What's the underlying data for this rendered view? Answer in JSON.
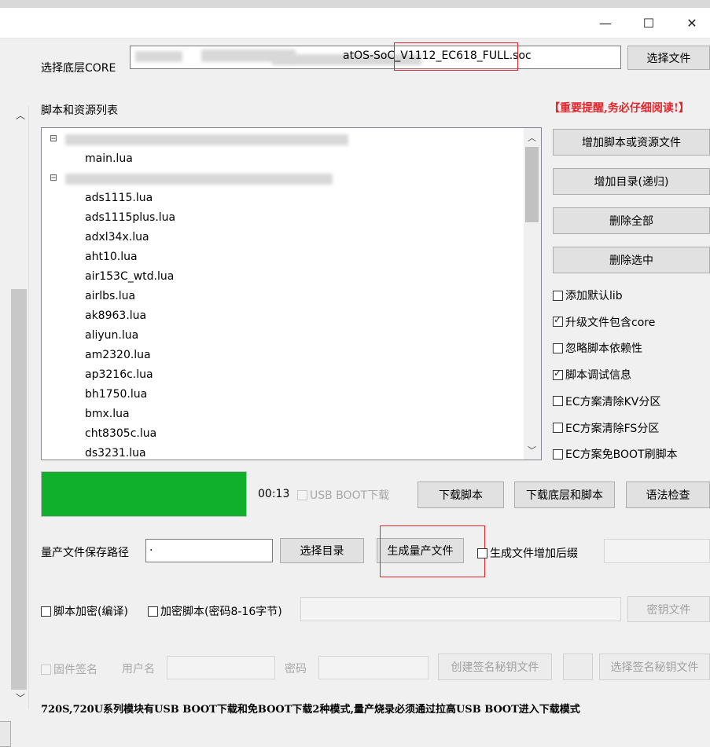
{
  "window": {
    "minimize": "—",
    "maximize": "☐",
    "close": "✕"
  },
  "core": {
    "label": "选择底层CORE",
    "path_value": "atOS-SoC_V1112_EC618_FULL.soc",
    "select_button": "选择文件"
  },
  "scripts": {
    "label": "脚本和资源列表",
    "warning": "【重要提醒,务必仔细阅读!】",
    "tree": [
      {
        "text": "⊟",
        "kind": "expander"
      },
      {
        "text": "main.lua",
        "kind": "file"
      },
      {
        "text": "⊟",
        "kind": "expander"
      },
      {
        "text": "ads1115.lua",
        "kind": "file"
      },
      {
        "text": "ads1115plus.lua",
        "kind": "file"
      },
      {
        "text": "adxl34x.lua",
        "kind": "file"
      },
      {
        "text": "aht10.lua",
        "kind": "file"
      },
      {
        "text": "air153C_wtd.lua",
        "kind": "file"
      },
      {
        "text": "airlbs.lua",
        "kind": "file"
      },
      {
        "text": "ak8963.lua",
        "kind": "file"
      },
      {
        "text": "aliyun.lua",
        "kind": "file"
      },
      {
        "text": "am2320.lua",
        "kind": "file"
      },
      {
        "text": "ap3216c.lua",
        "kind": "file"
      },
      {
        "text": "bh1750.lua",
        "kind": "file"
      },
      {
        "text": "bmx.lua",
        "kind": "file"
      },
      {
        "text": "cht8305c.lua",
        "kind": "file"
      },
      {
        "text": "ds3231.lua",
        "kind": "file"
      }
    ],
    "buttons": [
      "增加脚本或资源文件",
      "增加目录(递归)",
      "删除全部",
      "删除选中"
    ],
    "options": [
      {
        "label": "添加默认lib",
        "checked": false
      },
      {
        "label": "升级文件包含core",
        "checked": true
      },
      {
        "label": "忽略脚本依赖性",
        "checked": false
      },
      {
        "label": "脚本调试信息",
        "checked": true
      },
      {
        "label": "EC方案清除KV分区",
        "checked": false
      },
      {
        "label": "EC方案清除FS分区",
        "checked": false
      },
      {
        "label": "EC方案免BOOT刷脚本",
        "checked": false
      }
    ]
  },
  "download": {
    "progress_color": "#11b02c",
    "progress_fraction": 1.0,
    "timer": "00:13",
    "usb_boot_label": "USB BOOT下载",
    "download_script": "下载脚本",
    "download_core_script": "下载底层和脚本",
    "syntax_check": "语法检查"
  },
  "production": {
    "path_label": "量产文件保存路径",
    "path_value": ".",
    "select_dir": "选择目录",
    "generate": "生成量产文件",
    "suffix_label": "生成文件增加后缀"
  },
  "encrypt": {
    "encrypt_label": "脚本加密(编译)",
    "encrypt_key_label": "加密脚本(密码8-16字节)",
    "key_file": "密钥文件"
  },
  "sign": {
    "firmware_sign": "固件签名",
    "username_label": "用户名",
    "password_label": "密码",
    "create_key": "创建签名秘钥文件",
    "select_key": "选择签名秘钥文件"
  },
  "footer_note": "720S,720U系列模块有USB BOOT下载和免BOOT下载2种模式,量产烧录必须通过拉高USB BOOT进入下载模式"
}
